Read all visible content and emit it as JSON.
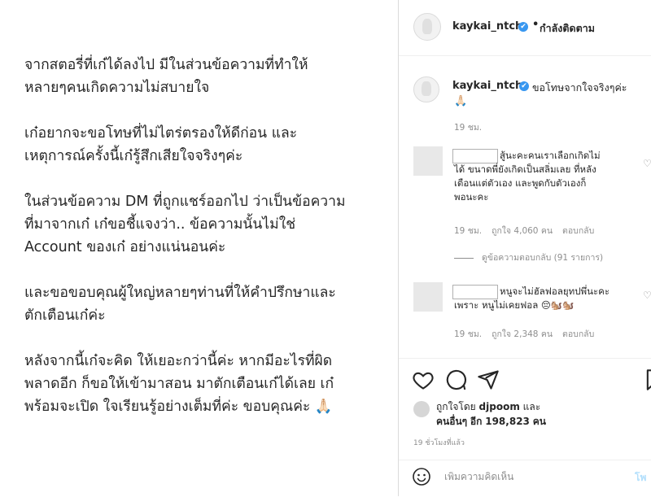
{
  "post": {
    "paragraphs": [
      [
        "จากสตอรี่ที่เก๋ได้ลงไป มีในส่วนข้อความที่ทำให้",
        "หลายๆคนเกิดความไม่สบายใจ"
      ],
      [
        "เก๋อยากจะขอโทษที่ไม่ไตร่ตรองให้ดีก่อน และ",
        "เหตุการณ์ครั้งนี้เก๋รู้สึกเสียใจจริงๆค่ะ"
      ],
      [
        "ในส่วนข้อความ DM ที่ถูกแชร์ออกไป ว่าเป็นข้อความ",
        "ที่มาจากเก๋ เก๋ขอชี้แจงว่า.. ข้อความนั้นไม่ใช่",
        "Account ของเก๋ อย่างแน่นอนค่ะ"
      ],
      [
        "และขอขอบคุณผู้ใหญ่หลายๆท่านที่ให้คำปรึกษาและ",
        "ตักเตือนเก๋ค่ะ"
      ],
      [
        "หลังจากนี้เก๋จะคิด ให้เยอะกว่านี้ค่ะ หากมีอะไรที่ผิด",
        "พลาดอีก ก็ขอให้เข้ามาสอน มาตักเตือนเก๋ได้เลย เก๋",
        "พร้อมจะเปิด ใจเรียนรู้อย่างเต็มที่ค่ะ ขอบคุณค่ะ 🙏🏻"
      ]
    ]
  },
  "header": {
    "username": "kaykai_ntch",
    "verified_mark": "✔",
    "dot": "•",
    "follow_status": "กำลังติดตาม"
  },
  "caption": {
    "username": "kaykai_ntch",
    "text": "ขอโทษจากใจจริงๆค่ะ",
    "emoji": "🙏🏻",
    "time": "19 ชม."
  },
  "comments": [
    {
      "lines": [
        "สู้นะคะคนเราเลือกเกิดไม่",
        "ได้ ขนาดพี่ยังเกิดเป็นสลิ่มเลย ที่หลัง",
        "เตือนแต่ตัวเอง และพูดกับตัวเองก็",
        "พอนะคะ"
      ],
      "time": "19 ชม.",
      "likes": "ถูกใจ 4,060 คน",
      "reply": "ตอบกลับ"
    },
    {
      "lines": [
        "หนูจะไม่ฮัลฟอลยุทปพึ่นะคะ",
        "เพราะ หนูไม่เคยฟอล 😔🐿️🐿️"
      ],
      "time": "19 ชม.",
      "likes": "ถูกใจ 2,348 คน",
      "reply": "ตอบกลับ"
    }
  ],
  "view_replies": "ดูข้อความตอบกลับ (91 รายการ)",
  "likes": {
    "line1_prefix": "ถูกใจโดย",
    "liker": "djpoom",
    "line1_suffix": "และ",
    "line2_others": "คนอื่นๆ",
    "line2_mid": "อีก",
    "count": "198,823",
    "line2_suffix": "คน"
  },
  "post_time": "19 ชั่วโมงที่แล้ว",
  "comment_box": {
    "placeholder": "เพิ่มความคิดเห็น",
    "post_label": "โพ"
  },
  "icons": {
    "heart": "heart-icon",
    "comment": "comment-icon",
    "share": "share-icon",
    "bookmark": "bookmark-icon",
    "emoji": "emoji-icon"
  },
  "colors": {
    "verified": "#3897f0",
    "secondary_text": "#8e8e8e",
    "post_button": "#b2dffc"
  }
}
